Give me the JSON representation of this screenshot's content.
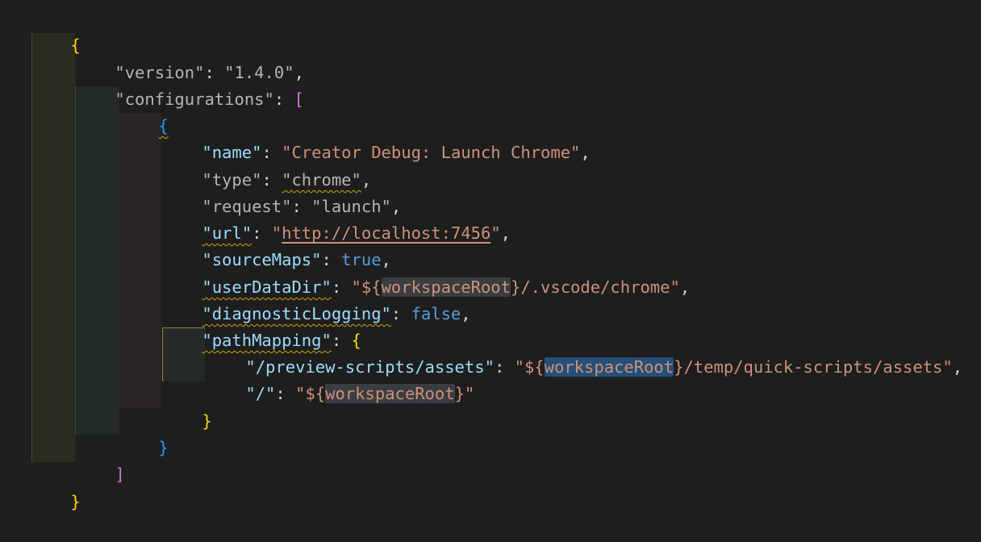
{
  "editor": {
    "lines": [
      [
        {
          "t": "{",
          "c": "br1"
        }
      ],
      [
        {
          "t": "\"version\"",
          "c": "k-dim"
        },
        {
          "t": ": ",
          "c": "p"
        },
        {
          "t": "\"1.4.0\"",
          "c": "s-dim"
        },
        {
          "t": ",",
          "c": "p"
        }
      ],
      [
        {
          "t": "\"configurations\"",
          "c": "k-dim"
        },
        {
          "t": ": ",
          "c": "p"
        },
        {
          "t": "[",
          "c": "br2"
        }
      ],
      [
        {
          "t": "{",
          "c": "br3"
        }
      ],
      [
        {
          "t": "\"name\"",
          "c": "k"
        },
        {
          "t": ": ",
          "c": "p"
        },
        {
          "t": "\"Creator Debug: Launch Chrome\"",
          "c": "s"
        },
        {
          "t": ",",
          "c": "p"
        }
      ],
      [
        {
          "t": "\"type\"",
          "c": "k-dim"
        },
        {
          "t": ": ",
          "c": "p"
        },
        {
          "t": "\"chrome\"",
          "c": "s-dim"
        },
        {
          "t": ",",
          "c": "p"
        }
      ],
      [
        {
          "t": "\"request\"",
          "c": "k-dim"
        },
        {
          "t": ": ",
          "c": "p"
        },
        {
          "t": "\"launch\"",
          "c": "s-dim"
        },
        {
          "t": ",",
          "c": "p"
        }
      ],
      [
        {
          "t": "\"url\"",
          "c": "k"
        },
        {
          "t": ": ",
          "c": "p"
        },
        {
          "t": "\"",
          "c": "s"
        },
        {
          "t": "http://localhost:7456",
          "c": "s"
        },
        {
          "t": "\"",
          "c": "s"
        },
        {
          "t": ",",
          "c": "p"
        }
      ],
      [
        {
          "t": "\"sourceMaps\"",
          "c": "k"
        },
        {
          "t": ": ",
          "c": "p"
        },
        {
          "t": "true",
          "c": "b"
        },
        {
          "t": ",",
          "c": "p"
        }
      ],
      [
        {
          "t": "\"userDataDir\"",
          "c": "k"
        },
        {
          "t": ": ",
          "c": "p"
        },
        {
          "t": "\"${",
          "c": "s"
        },
        {
          "t": "workspaceRoot",
          "c": "s"
        },
        {
          "t": "}/.vscode/chrome\"",
          "c": "s"
        },
        {
          "t": ",",
          "c": "p"
        }
      ],
      [
        {
          "t": "\"diagnosticLogging\"",
          "c": "k"
        },
        {
          "t": ": ",
          "c": "p"
        },
        {
          "t": "false",
          "c": "b"
        },
        {
          "t": ",",
          "c": "p"
        }
      ],
      [
        {
          "t": "\"pathMapping\"",
          "c": "k"
        },
        {
          "t": ": ",
          "c": "p"
        },
        {
          "t": "{",
          "c": "br1"
        }
      ],
      [
        {
          "t": "\"/preview-scripts/assets\"",
          "c": "k"
        },
        {
          "t": ": ",
          "c": "p"
        },
        {
          "t": "\"${",
          "c": "s"
        },
        {
          "t": "workspaceRoot",
          "c": "s"
        },
        {
          "t": "}/temp/quick-scripts/assets\"",
          "c": "s"
        },
        {
          "t": ",",
          "c": "p"
        }
      ],
      [
        {
          "t": "\"/\"",
          "c": "k"
        },
        {
          "t": ": ",
          "c": "p"
        },
        {
          "t": "\"${",
          "c": "s"
        },
        {
          "t": "workspaceRoot",
          "c": "s"
        },
        {
          "t": "}\"",
          "c": "s"
        }
      ],
      [
        {
          "t": "}",
          "c": "br1"
        }
      ],
      [
        {
          "t": "}",
          "c": "br3"
        }
      ],
      [
        {
          "t": "]",
          "c": "br2"
        }
      ],
      [
        {
          "t": "}",
          "c": "br1"
        }
      ]
    ]
  },
  "colors": {
    "background": "#1e1e1e",
    "property_key": "#9cdcfe",
    "string_value": "#ce9178",
    "boolean": "#569cd6",
    "bracket_level1": "#ffd700",
    "bracket_level2": "#da70d6",
    "bracket_level3": "#179fff",
    "warning_squiggle": "#cca700",
    "selection_highlight": "#264f78"
  }
}
